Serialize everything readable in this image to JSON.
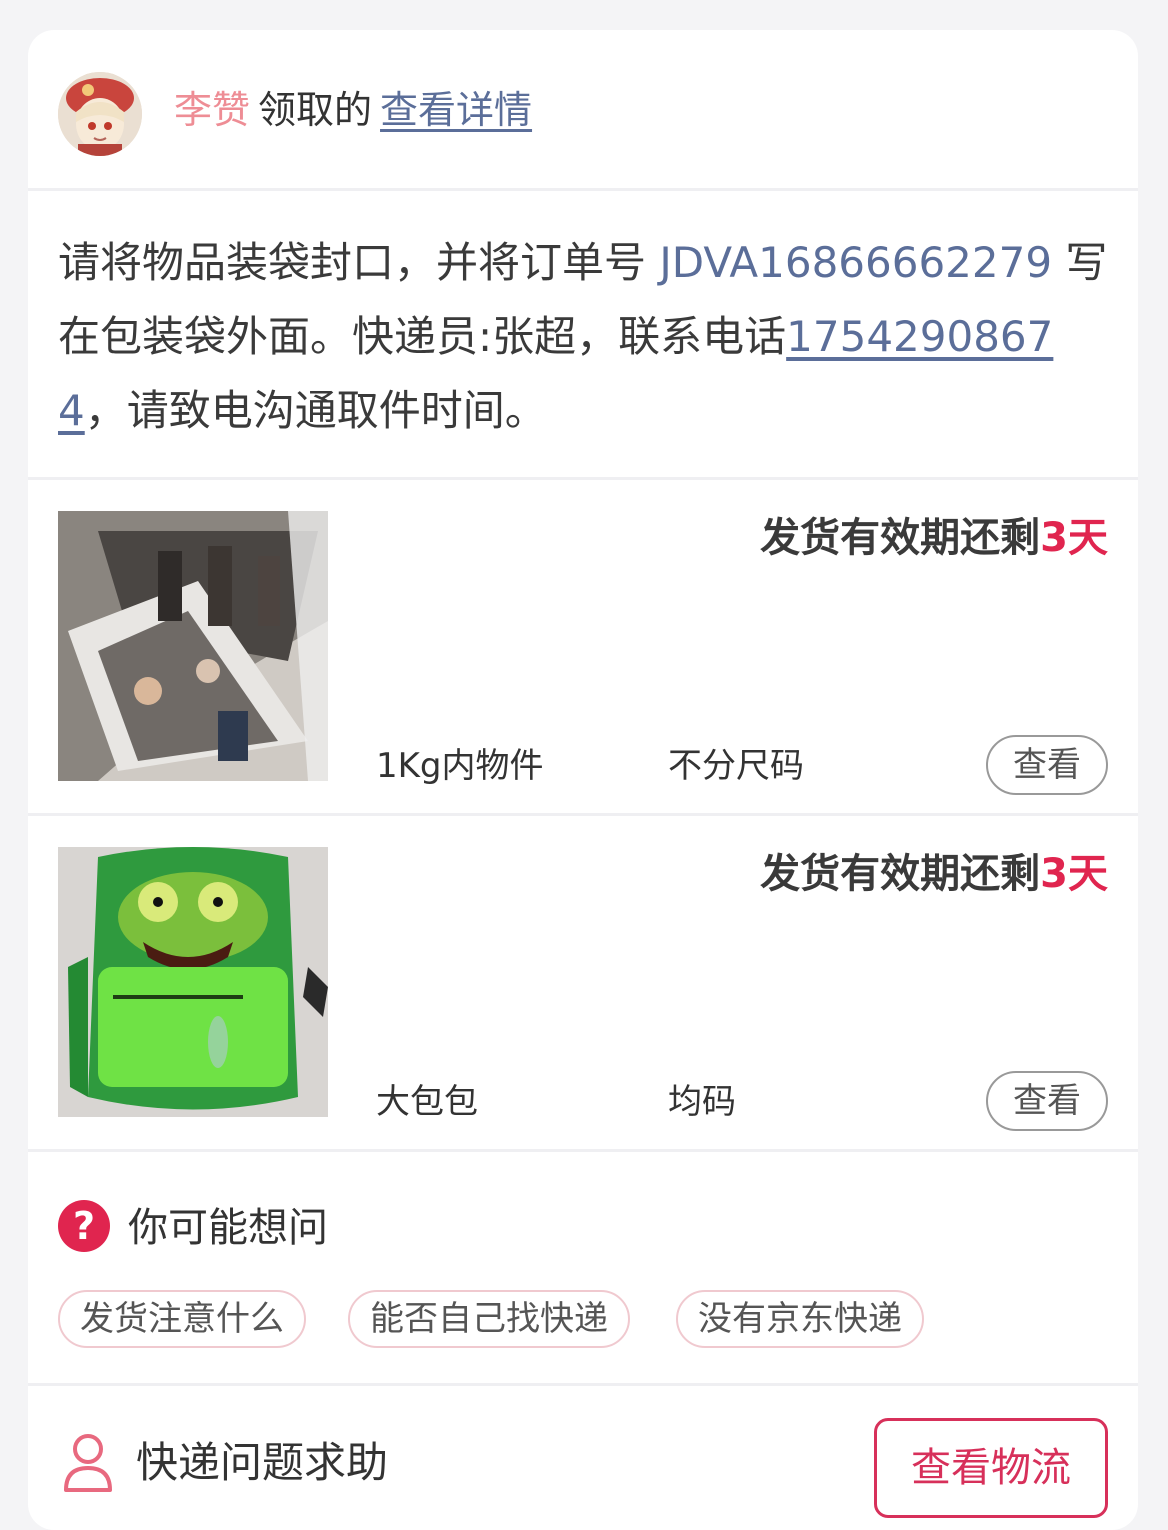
{
  "header": {
    "name": "李赞",
    "verb": "领取的",
    "detail_link": "查看详情"
  },
  "instruction": {
    "part1": "请将物品装袋封口，并将订单号 ",
    "order_no": "JDVA16866662279",
    "part2": " 写在包装袋外面。快递员:张超，联系电话",
    "phone": "17542908674",
    "part3": "，请致电沟通取件时间。"
  },
  "items": [
    {
      "validity_prefix": "发货有效期还剩",
      "days": "3天",
      "weight": "1Kg内物件",
      "size": "不分尺码",
      "view_label": "查看",
      "image": "posters-photo"
    },
    {
      "validity_prefix": "发货有效期还剩",
      "days": "3天",
      "weight": "大包包",
      "size": "均码",
      "view_label": "查看",
      "image": "green-backpack-photo"
    }
  ],
  "faq": {
    "title": "你可能想问",
    "chips": [
      "发货注意什么",
      "能否自己找快递",
      "没有京东快递"
    ]
  },
  "footer": {
    "help_label": "快递问题求助",
    "logistics_button": "查看物流"
  },
  "colors": {
    "accent": "#e0254f",
    "link": "#5b6e99",
    "name": "#ee8d95"
  }
}
